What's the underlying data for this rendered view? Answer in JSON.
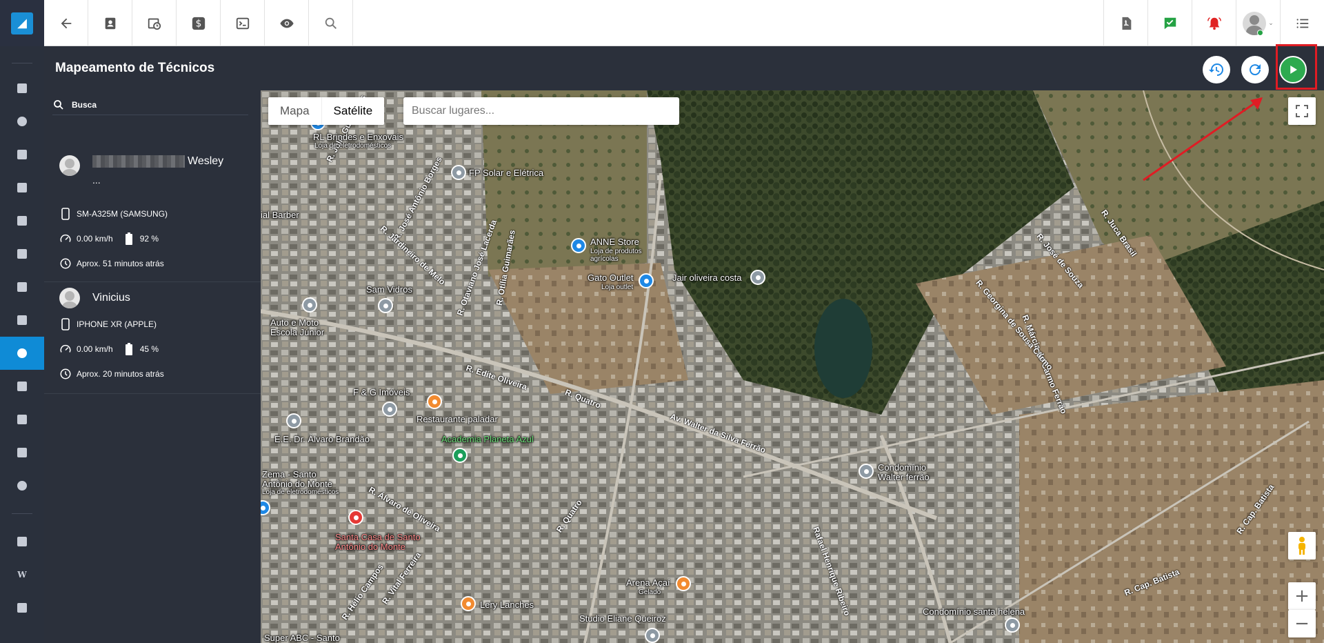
{
  "header": {
    "title": "Mapeamento de Técnicos"
  },
  "panel": {
    "search_placeholder": "Busca",
    "technicians": [
      {
        "name": "Wesley",
        "name_extra": "...",
        "device": "SM-A325M (SAMSUNG)",
        "speed": "0.00 km/h",
        "battery": "92 %",
        "last_seen": "Aprox. 51 minutos atrás"
      },
      {
        "name": "Vinicius",
        "device": "IPHONE XR (APPLE)",
        "speed": "0.00 km/h",
        "battery": "45 %",
        "last_seen": "Aprox. 20 minutos atrás"
      }
    ]
  },
  "map": {
    "type_map": "Mapa",
    "type_satellite": "Satélite",
    "places_placeholder": "Buscar lugares...",
    "zoom_in": "+",
    "zoom_out": "−",
    "places": [
      {
        "name": "RL Brindes e Enxovais",
        "sub": "Loja de eletrodomésticos"
      },
      {
        "name": "FP Solar e Elétrica"
      },
      {
        "name": "ANNE Store",
        "sub": "Loja de produtos agrícolas"
      },
      {
        "name": "Gato Outlet",
        "sub": "Loja outlet"
      },
      {
        "name": "Jair oliveira costa"
      },
      {
        "name": "Sam Vidros"
      },
      {
        "name": "Auto e Moto Escola Júnior"
      },
      {
        "name": "F & G Imóveis"
      },
      {
        "name": "Restaurante paladar"
      },
      {
        "name": "Academia Planeta Azul"
      },
      {
        "name": "E.E. Dr. Álvaro Brandão"
      },
      {
        "name": "Zema - Santo Antônio do Monte",
        "sub": "Loja de eletrodomésticos"
      },
      {
        "name": "Santa Casa de Santo Antônio do Monte"
      },
      {
        "name": "Condomínio Walter ferrão"
      },
      {
        "name": "Arena Açaí",
        "sub": "Gelado"
      },
      {
        "name": "Lery Lanches"
      },
      {
        "name": "Studio Eliane Queiroz"
      },
      {
        "name": "Condomínio santa helena"
      },
      {
        "name": "Super ABC - Santo"
      },
      {
        "name": "ial Barber"
      }
    ],
    "roads": [
      "R. José Antônio Borges",
      "R. Júlia Guimarães",
      "R. Jardineiro de Melo",
      "R. Otaviano José Lacerda",
      "R. Otília Guimarães",
      "R. Edite Oliveira",
      "R. Quatro",
      "Av. Walter da Silva Ferrão",
      "R. Álvaro de Oliveira",
      "R. Márcia do Carmo Ferrão",
      "R. Georgina de Sousa Carmo",
      "R. José de Souza",
      "R. Juca Brasil",
      "R. Cap. Batista",
      "R. Vital Ferreira",
      "R. Hélio Campos",
      "Rafael Henrique Ribeiro",
      "R. Quatro"
    ]
  },
  "colors": {
    "accent": "#0f8bd6",
    "play": "#2daa4f",
    "highlight": "#e01c24"
  }
}
